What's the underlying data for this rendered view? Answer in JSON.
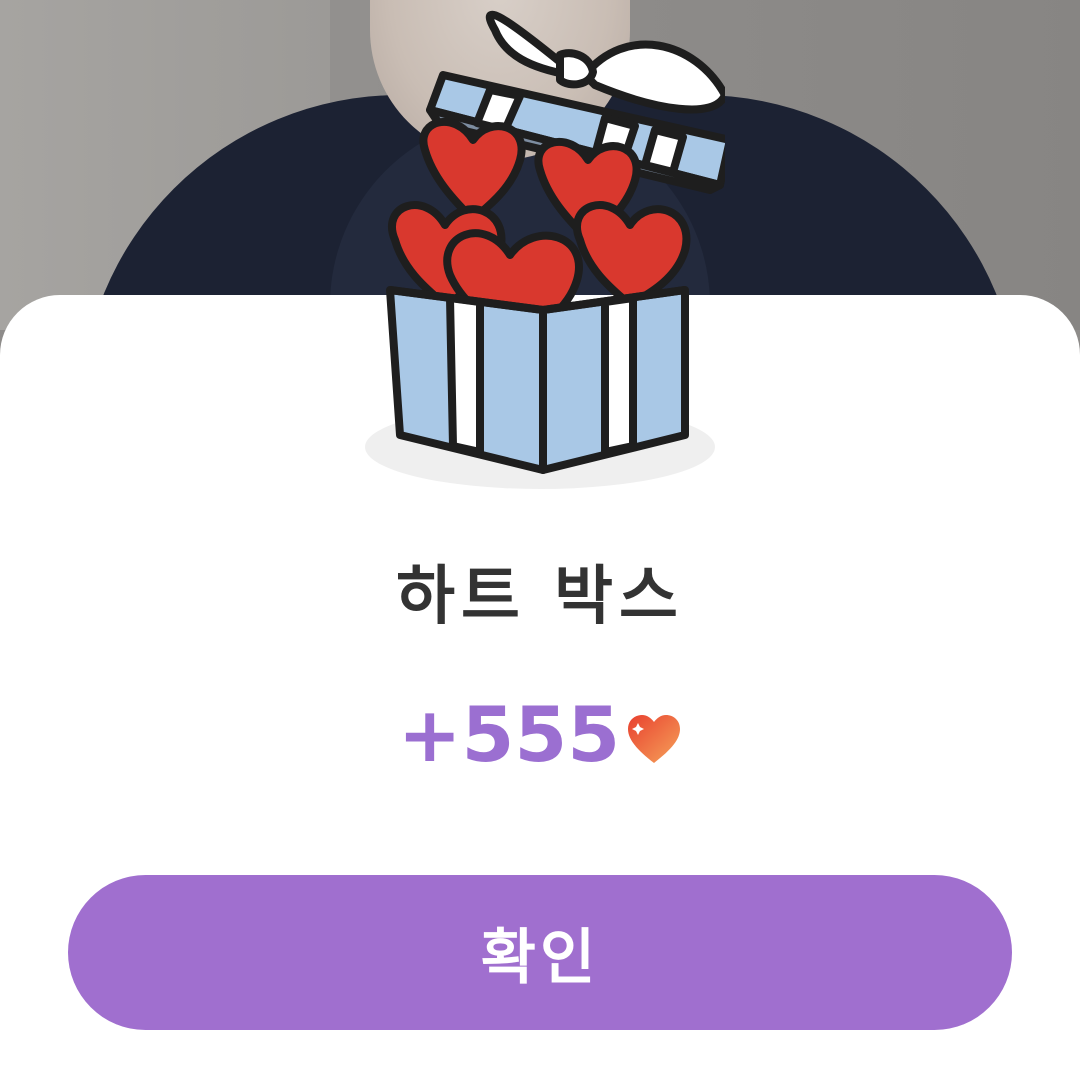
{
  "background": {
    "description_icon": "video-frame"
  },
  "dialog": {
    "illustration_icon": "heart-gift-box-icon",
    "title": "하트 박스",
    "reward": {
      "amount": "+555",
      "icon": "heart-icon"
    },
    "confirm_label": "확인"
  },
  "colors": {
    "accent": "#a06fcf",
    "reward_text": "#9b6fd1",
    "title_text": "#333333",
    "heart": "#d9382e",
    "box_blue": "#a9c8e6"
  }
}
